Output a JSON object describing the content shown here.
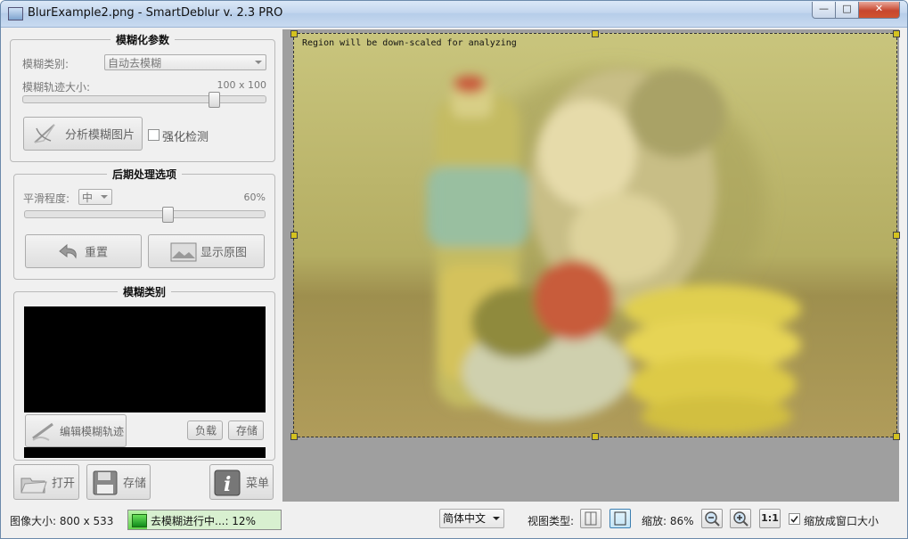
{
  "window": {
    "title": "BlurExample2.png - SmartDeblur v. 2.3 PRO",
    "min_label": "—",
    "max_label": "□",
    "close_label": "✕"
  },
  "blur_params": {
    "title": "模糊化参数",
    "type_label": "模糊类别:",
    "type_value": "自动去模糊",
    "size_label": "模糊轨迹大小:",
    "size_value": "100 x 100",
    "size_level": 0.8,
    "analyze_button": "分析模糊图片",
    "enhance_label": "强化检测",
    "enhance_checked": false
  },
  "post": {
    "title": "后期处理选项",
    "smooth_label": "平滑程度:",
    "smooth_value": "中",
    "smooth_percent": "60%",
    "smooth_level": 0.6,
    "reset_button": "重置",
    "show_original_button": "显示原图"
  },
  "kernel": {
    "title": "模糊类别",
    "edit_button": "编辑模糊轨迹",
    "load_button": "负载",
    "save_button": "存储"
  },
  "bottom_buttons": {
    "open": "打开",
    "save": "存储",
    "menu": "菜单"
  },
  "canvas": {
    "region_text": "Region will be down-scaled for analyzing"
  },
  "status": {
    "image_size": "图像大小: 800 x 533",
    "progress_text": "去模糊进行中...: 12%",
    "progress_level": 0.12,
    "language": "简体中文",
    "view_type_label": "视图类型:",
    "zoom_label": "缩放: 86%",
    "zoom_1to1": "1:1",
    "fit_label": "缩放成窗口大小",
    "fit_checked": true
  },
  "colors": {
    "progress_green": "#63d44e",
    "selection_handle": "#d4c21f"
  }
}
